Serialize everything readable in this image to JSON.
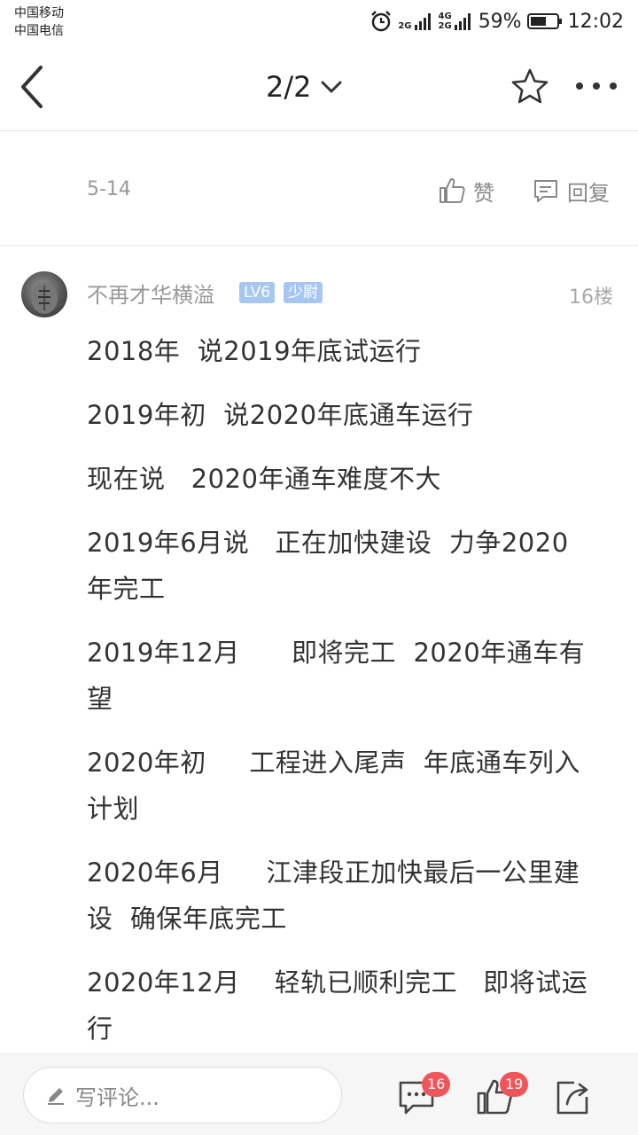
{
  "status_bar": {
    "carrier1": "中国移动",
    "carrier2": "中国电信",
    "net1": "2G",
    "net2": "4G",
    "net3": "2G",
    "battery": "59%",
    "time": "12:02"
  },
  "header": {
    "page_indicator": "2/2",
    "icons": [
      "back-arrow-icon",
      "chevron-down-icon",
      "star-icon",
      "more-icon"
    ]
  },
  "meta": {
    "date": "5-14",
    "like_label": "赞",
    "reply_label": "回复"
  },
  "post": {
    "username": "不再才华横溢",
    "level_badge": "LV6",
    "rank_badge": "少尉",
    "floor": "16楼",
    "lines": [
      "2018年  说2019年底试运行",
      "2019年初  说2020年底通车运行",
      "现在说   2020年通车难度不大",
      "2019年6月说   正在加快建设  力争2020年完工",
      "2019年12月      即将完工  2020年通车有望",
      "2020年初     工程进入尾声  年底通车列入计划",
      "2020年6月     江津段正加快最后一公里建设  确保年底完工",
      "2020年12月    轻轨已顺利完工   即将试运行"
    ]
  },
  "bottom_bar": {
    "input_placeholder": "写评论...",
    "comment_count": "16",
    "like_count": "19"
  },
  "colors": {
    "badge": "#a7c7f2",
    "count_badge": "#f0555a",
    "text": "#333333",
    "muted": "#999999"
  }
}
